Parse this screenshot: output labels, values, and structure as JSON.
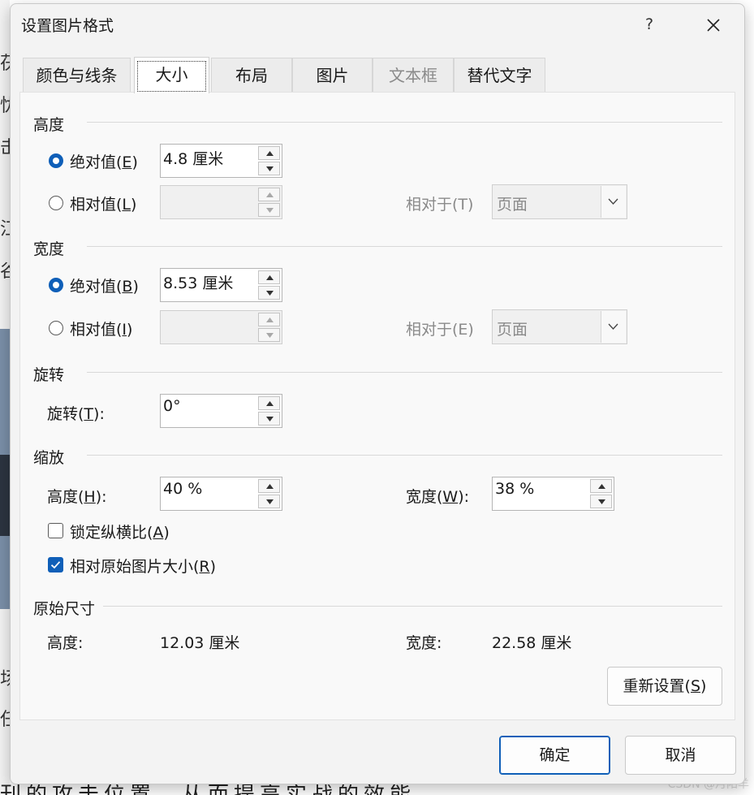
{
  "background": {
    "frag1": "茯",
    "frag2": "忧",
    "frag3": "击",
    "frag4": "江",
    "frag5": "谷",
    "frag6": "场",
    "frag7": "任",
    "bottom_text": "刊的攻击位置，从而提高实战的效能",
    "watermark": "CSDN @月阳羊"
  },
  "dialog": {
    "title": "设置图片格式",
    "help": "?",
    "tabs": [
      {
        "label": "颜色与线条"
      },
      {
        "label": "大小"
      },
      {
        "label": "布局"
      },
      {
        "label": "图片"
      },
      {
        "label": "文本框"
      },
      {
        "label": "替代文字"
      }
    ],
    "height_section": {
      "title": "高度",
      "absolute_label": "绝对值(",
      "absolute_key": "E",
      "absolute_value": "4.8 厘米",
      "relative_label": "相对值(",
      "relative_key": "L",
      "relative_to_label": "相对于(T)",
      "relative_to_value": "页面"
    },
    "width_section": {
      "title": "宽度",
      "absolute_label": "绝对值(",
      "absolute_key": "B",
      "absolute_value": "8.53 厘米",
      "relative_label": "相对值(",
      "relative_key": "I",
      "relative_to_label": "相对于(E)",
      "relative_to_value": "页面"
    },
    "rotate_section": {
      "title": "旋转",
      "label": "旋转(",
      "key": "T",
      "value": "0°"
    },
    "scale_section": {
      "title": "缩放",
      "height_label": "高度(",
      "height_key": "H",
      "height_value": "40 %",
      "width_label": "宽度(",
      "width_key": "W",
      "width_value": "38 %",
      "lock_label": "锁定纵横比(",
      "lock_key": "A",
      "relative_label": "相对原始图片大小(",
      "relative_key": "R"
    },
    "original_section": {
      "title": "原始尺寸",
      "height_label": "高度:",
      "height_value": "12.03 厘米",
      "width_label": "宽度:",
      "width_value": "22.58 厘米"
    },
    "reset_label": "重新设置(",
    "reset_key": "S",
    "ok_label": "确定",
    "cancel_label": "取消"
  },
  "colors": {
    "accent": "#0f5fb8",
    "dialog_bg": "#f3f3f3",
    "panel_bg": "#f9f9f9"
  }
}
